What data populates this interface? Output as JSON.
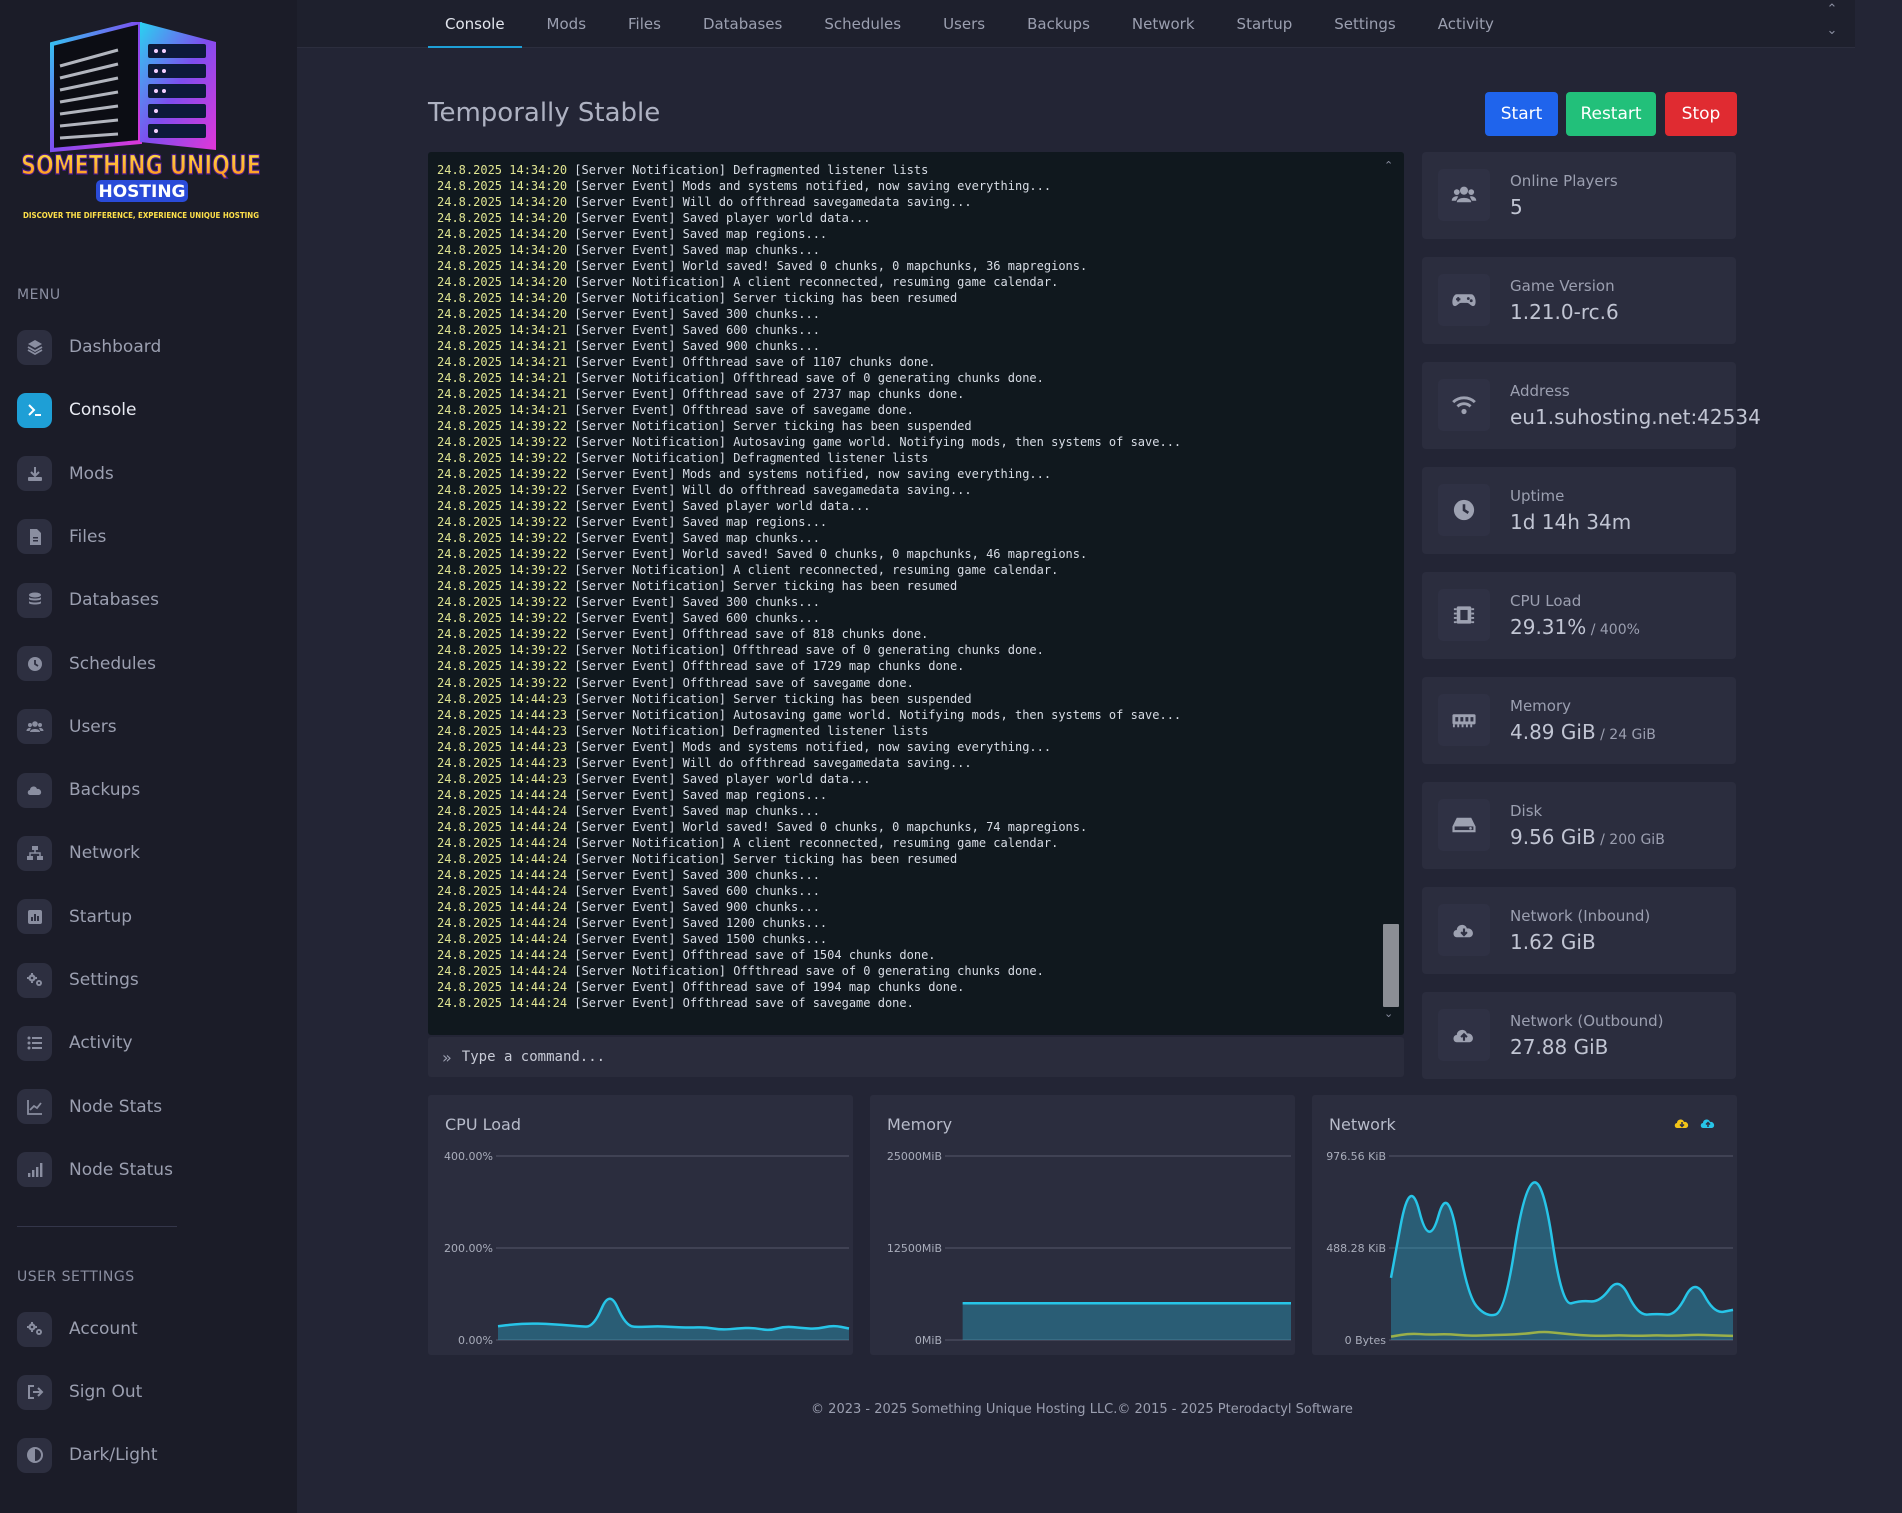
{
  "brand": {
    "line1": "SOMETHING UNIQUE",
    "line2": "HOSTING",
    "tagline": "DISCOVER THE DIFFERENCE, EXPERIENCE UNIQUE HOSTING"
  },
  "sidebar": {
    "menu_heading": "MENU",
    "menu_items": [
      {
        "label": "Dashboard",
        "icon": "layers-icon"
      },
      {
        "label": "Console",
        "icon": "terminal-icon",
        "active": true
      },
      {
        "label": "Mods",
        "icon": "download-icon"
      },
      {
        "label": "Files",
        "icon": "file-icon"
      },
      {
        "label": "Databases",
        "icon": "database-icon"
      },
      {
        "label": "Schedules",
        "icon": "clock-icon"
      },
      {
        "label": "Users",
        "icon": "users-icon"
      },
      {
        "label": "Backups",
        "icon": "cloud-icon"
      },
      {
        "label": "Network",
        "icon": "network-icon"
      },
      {
        "label": "Startup",
        "icon": "chart-box-icon"
      },
      {
        "label": "Settings",
        "icon": "gears-icon"
      },
      {
        "label": "Activity",
        "icon": "list-icon"
      },
      {
        "label": "Node Stats",
        "icon": "line-chart-icon"
      },
      {
        "label": "Node Status",
        "icon": "signal-bars-icon"
      }
    ],
    "user_heading": "USER SETTINGS",
    "user_items": [
      {
        "label": "Account",
        "icon": "gears-icon"
      },
      {
        "label": "Sign Out",
        "icon": "sign-out-icon"
      },
      {
        "label": "Dark/Light",
        "icon": "contrast-icon"
      }
    ]
  },
  "tabs": [
    "Console",
    "Mods",
    "Files",
    "Databases",
    "Schedules",
    "Users",
    "Backups",
    "Network",
    "Startup",
    "Settings",
    "Activity"
  ],
  "active_tab": "Console",
  "server": {
    "name": "Temporally Stable"
  },
  "buttons": {
    "start": "Start",
    "restart": "Restart",
    "stop": "Stop"
  },
  "colors": {
    "accent": "#1e9fd6",
    "start": "#1f64ec",
    "restart": "#22c07a",
    "stop": "#e02b31",
    "graph_line": "#27c5e8",
    "graph_line_out": "#9ab04a"
  },
  "console": {
    "lines": [
      [
        "24.8.2025 14:34:20",
        "[Server Notification] Defragmented listener lists"
      ],
      [
        "24.8.2025 14:34:20",
        "[Server Event] Mods and systems notified, now saving everything..."
      ],
      [
        "24.8.2025 14:34:20",
        "[Server Event] Will do offthread savegamedata saving..."
      ],
      [
        "24.8.2025 14:34:20",
        "[Server Event] Saved player world data..."
      ],
      [
        "24.8.2025 14:34:20",
        "[Server Event] Saved map regions..."
      ],
      [
        "24.8.2025 14:34:20",
        "[Server Event] Saved map chunks..."
      ],
      [
        "24.8.2025 14:34:20",
        "[Server Event] World saved! Saved 0 chunks, 0 mapchunks, 36 mapregions."
      ],
      [
        "24.8.2025 14:34:20",
        "[Server Notification] A client reconnected, resuming game calendar."
      ],
      [
        "24.8.2025 14:34:20",
        "[Server Notification] Server ticking has been resumed"
      ],
      [
        "24.8.2025 14:34:20",
        "[Server Event] Saved 300 chunks..."
      ],
      [
        "24.8.2025 14:34:21",
        "[Server Event] Saved 600 chunks..."
      ],
      [
        "24.8.2025 14:34:21",
        "[Server Event] Saved 900 chunks..."
      ],
      [
        "24.8.2025 14:34:21",
        "[Server Event] Offthread save of 1107 chunks done."
      ],
      [
        "24.8.2025 14:34:21",
        "[Server Notification] Offthread save of 0 generating chunks done."
      ],
      [
        "24.8.2025 14:34:21",
        "[Server Event] Offthread save of 2737 map chunks done."
      ],
      [
        "24.8.2025 14:34:21",
        "[Server Event] Offthread save of savegame done."
      ],
      [
        "24.8.2025 14:39:22",
        "[Server Notification] Server ticking has been suspended"
      ],
      [
        "24.8.2025 14:39:22",
        "[Server Notification] Autosaving game world. Notifying mods, then systems of save..."
      ],
      [
        "24.8.2025 14:39:22",
        "[Server Notification] Defragmented listener lists"
      ],
      [
        "24.8.2025 14:39:22",
        "[Server Event] Mods and systems notified, now saving everything..."
      ],
      [
        "24.8.2025 14:39:22",
        "[Server Event] Will do offthread savegamedata saving..."
      ],
      [
        "24.8.2025 14:39:22",
        "[Server Event] Saved player world data..."
      ],
      [
        "24.8.2025 14:39:22",
        "[Server Event] Saved map regions..."
      ],
      [
        "24.8.2025 14:39:22",
        "[Server Event] Saved map chunks..."
      ],
      [
        "24.8.2025 14:39:22",
        "[Server Event] World saved! Saved 0 chunks, 0 mapchunks, 46 mapregions."
      ],
      [
        "24.8.2025 14:39:22",
        "[Server Notification] A client reconnected, resuming game calendar."
      ],
      [
        "24.8.2025 14:39:22",
        "[Server Notification] Server ticking has been resumed"
      ],
      [
        "24.8.2025 14:39:22",
        "[Server Event] Saved 300 chunks..."
      ],
      [
        "24.8.2025 14:39:22",
        "[Server Event] Saved 600 chunks..."
      ],
      [
        "24.8.2025 14:39:22",
        "[Server Event] Offthread save of 818 chunks done."
      ],
      [
        "24.8.2025 14:39:22",
        "[Server Notification] Offthread save of 0 generating chunks done."
      ],
      [
        "24.8.2025 14:39:22",
        "[Server Event] Offthread save of 1729 map chunks done."
      ],
      [
        "24.8.2025 14:39:22",
        "[Server Event] Offthread save of savegame done."
      ],
      [
        "24.8.2025 14:44:23",
        "[Server Notification] Server ticking has been suspended"
      ],
      [
        "24.8.2025 14:44:23",
        "[Server Notification] Autosaving game world. Notifying mods, then systems of save..."
      ],
      [
        "24.8.2025 14:44:23",
        "[Server Notification] Defragmented listener lists"
      ],
      [
        "24.8.2025 14:44:23",
        "[Server Event] Mods and systems notified, now saving everything..."
      ],
      [
        "24.8.2025 14:44:23",
        "[Server Event] Will do offthread savegamedata saving..."
      ],
      [
        "24.8.2025 14:44:23",
        "[Server Event] Saved player world data..."
      ],
      [
        "24.8.2025 14:44:24",
        "[Server Event] Saved map regions..."
      ],
      [
        "24.8.2025 14:44:24",
        "[Server Event] Saved map chunks..."
      ],
      [
        "24.8.2025 14:44:24",
        "[Server Event] World saved! Saved 0 chunks, 0 mapchunks, 74 mapregions."
      ],
      [
        "24.8.2025 14:44:24",
        "[Server Notification] A client reconnected, resuming game calendar."
      ],
      [
        "24.8.2025 14:44:24",
        "[Server Notification] Server ticking has been resumed"
      ],
      [
        "24.8.2025 14:44:24",
        "[Server Event] Saved 300 chunks..."
      ],
      [
        "24.8.2025 14:44:24",
        "[Server Event] Saved 600 chunks..."
      ],
      [
        "24.8.2025 14:44:24",
        "[Server Event] Saved 900 chunks..."
      ],
      [
        "24.8.2025 14:44:24",
        "[Server Event] Saved 1200 chunks..."
      ],
      [
        "24.8.2025 14:44:24",
        "[Server Event] Saved 1500 chunks..."
      ],
      [
        "24.8.2025 14:44:24",
        "[Server Event] Offthread save of 1504 chunks done."
      ],
      [
        "24.8.2025 14:44:24",
        "[Server Notification] Offthread save of 0 generating chunks done."
      ],
      [
        "24.8.2025 14:44:24",
        "[Server Event] Offthread save of 1994 map chunks done."
      ],
      [
        "24.8.2025 14:44:24",
        "[Server Event] Offthread save of savegame done."
      ]
    ],
    "command_placeholder": "Type a command..."
  },
  "stats": [
    {
      "label": "Online Players",
      "value": "5",
      "sub": "",
      "icon": "users-icon"
    },
    {
      "label": "Game Version",
      "value": "1.21.0-rc.6",
      "sub": "",
      "icon": "gamepad-icon"
    },
    {
      "label": "Address",
      "value": "eu1.suhosting.net:42534",
      "sub": "",
      "icon": "wifi-icon"
    },
    {
      "label": "Uptime",
      "value": "1d 14h 34m",
      "sub": "",
      "icon": "clock-icon"
    },
    {
      "label": "CPU Load",
      "value": "29.31%",
      "sub": " / 400%",
      "icon": "cpu-icon"
    },
    {
      "label": "Memory",
      "value": "4.89 GiB",
      "sub": " / 24 GiB",
      "icon": "memory-icon"
    },
    {
      "label": "Disk",
      "value": "9.56 GiB",
      "sub": " / 200 GiB",
      "icon": "hdd-icon"
    },
    {
      "label": "Network (Inbound)",
      "value": "1.62 GiB",
      "sub": "",
      "icon": "cloud-download-icon"
    },
    {
      "label": "Network (Outbound)",
      "value": "27.88 GiB",
      "sub": "",
      "icon": "cloud-upload-icon"
    }
  ],
  "chart_data": [
    {
      "type": "area",
      "title": "CPU Load",
      "ytick_labels": [
        "400.00%",
        "200.00%",
        "0.00%"
      ],
      "ylim": [
        0,
        400
      ],
      "grid": true,
      "series": [
        {
          "values": [
            30,
            34,
            36,
            35,
            33,
            30,
            28,
            110,
            30,
            28,
            30,
            28,
            27,
            28,
            22,
            25,
            27,
            20,
            30,
            26,
            24,
            32,
            25
          ]
        }
      ]
    },
    {
      "type": "area",
      "title": "Memory",
      "ytick_labels": [
        "25000MiB",
        "12500MiB",
        "0MiB"
      ],
      "ylim": [
        0,
        25000
      ],
      "grid": true,
      "series": [
        {
          "values": [
            null,
            5000,
            5000,
            5000,
            5000,
            5000,
            5000,
            5000,
            5000,
            5000,
            5000,
            5000,
            5000,
            5000,
            5000,
            5000,
            5000,
            5000,
            5000,
            5000,
            5000,
            5000,
            5000
          ]
        }
      ]
    },
    {
      "type": "area",
      "title": "Network",
      "ytick_labels": [
        "976.56 KiB",
        "488.28 KiB",
        "0 Bytes"
      ],
      "ylim": [
        0,
        976.56
      ],
      "grid": true,
      "legend": [
        "cloud-download-icon",
        "cloud-upload-icon"
      ],
      "series": [
        {
          "values": [
            330,
            880,
            480,
            840,
            240,
            120,
            150,
            810,
            860,
            180,
            210,
            200,
            340,
            130,
            140,
            130,
            330,
            140,
            160
          ]
        },
        {
          "values": [
            18,
            35,
            28,
            32,
            22,
            25,
            28,
            32,
            45,
            35,
            25,
            22,
            25,
            22,
            25,
            22,
            28,
            25,
            22
          ]
        }
      ]
    }
  ],
  "footer": "© 2023 - 2025 Something Unique Hosting LLC.© 2015 - 2025 Pterodactyl Software"
}
